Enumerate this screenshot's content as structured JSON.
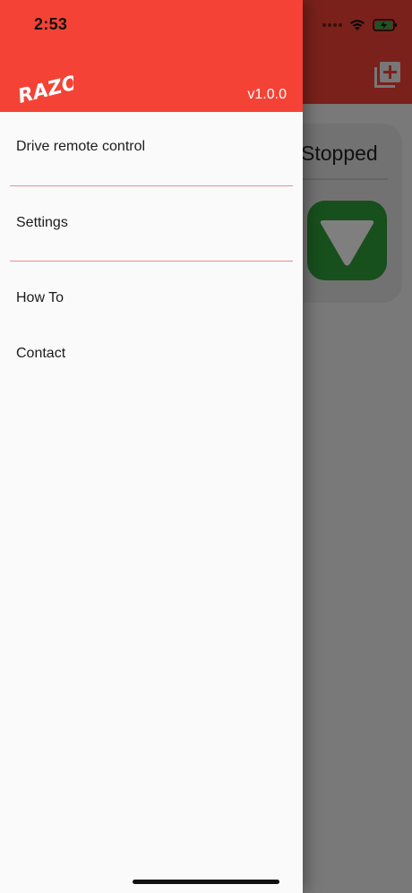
{
  "status_bar": {
    "time": "2:53"
  },
  "app": {
    "status_text": "Stopped",
    "add_icon": "add-box-icon",
    "stop_icon": "triangle-down-icon"
  },
  "drawer": {
    "logo_text": "RAZOR",
    "version": "v1.0.0",
    "items": [
      {
        "label": "Drive remote control"
      },
      {
        "label": "Settings"
      },
      {
        "label": "How To"
      },
      {
        "label": "Contact"
      }
    ]
  },
  "colors": {
    "primary": "#f44336",
    "stop_button": "#2e9e3a",
    "separator": "#f28b8b"
  }
}
